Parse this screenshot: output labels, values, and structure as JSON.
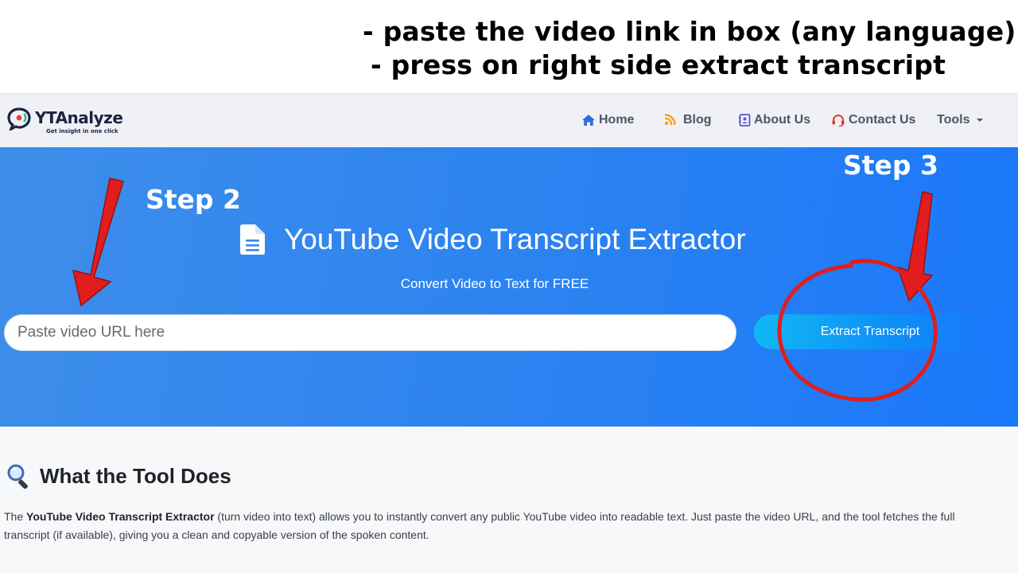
{
  "instructions": {
    "line1": "- paste the video link in box (any language)",
    "line2": "- press on right side extract transcript"
  },
  "logo": {
    "name": "YTAnalyze",
    "tagline": "Get insight in one click"
  },
  "nav": {
    "home": "Home",
    "blog": "Blog",
    "about": "About Us",
    "contact": "Contact Us",
    "tools": "Tools"
  },
  "hero": {
    "step2": "Step 2",
    "step3": "Step 3",
    "title": "YouTube Video Transcript Extractor",
    "subtitle": "Convert Video to Text for FREE",
    "input_placeholder": "Paste video URL here",
    "button_label": "Extract Transcript"
  },
  "section": {
    "title": "What the Tool Does",
    "desc_before": "The ",
    "desc_bold": "YouTube Video Transcript Extractor",
    "desc_after": " (turn video into text) allows you to instantly convert any public YouTube video into readable text. Just paste the video URL, and the tool fetches the full transcript (if available), giving you a clean and copyable version of the spoken content."
  },
  "colors": {
    "hero_start": "#3e8eea",
    "hero_end": "#1a78fb",
    "button_start": "#11b8f4",
    "annotation_red": "#e11d1d",
    "navbar_bg": "#f0f1f6"
  },
  "icons": {
    "home": "home-icon",
    "blog": "rss-icon",
    "about": "address-card-icon",
    "contact": "headset-icon",
    "title": "document-icon",
    "section": "magnifier-icon"
  }
}
